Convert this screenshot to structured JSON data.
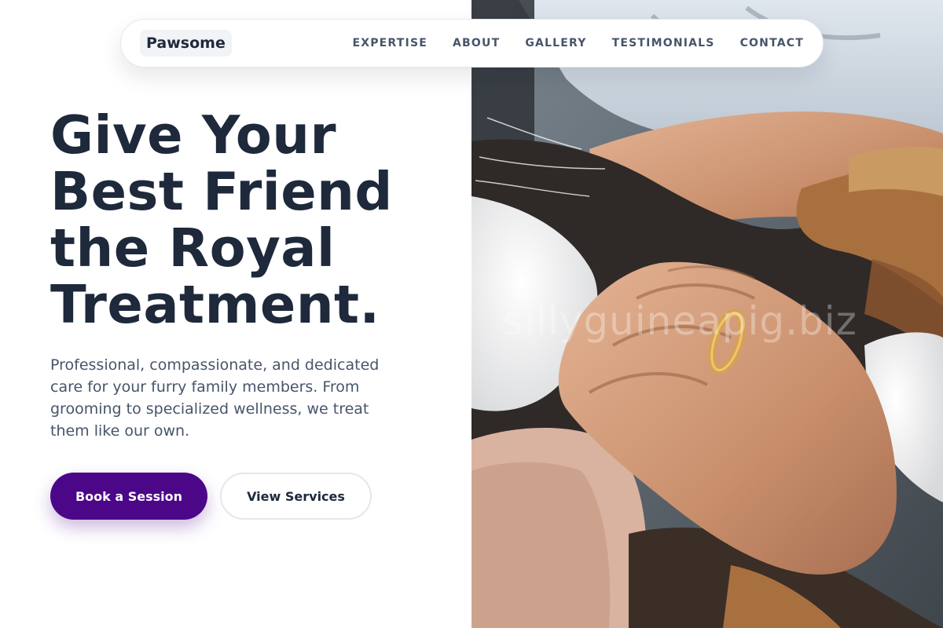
{
  "nav": {
    "brand": "Pawsome",
    "links": [
      "EXPERTISE",
      "ABOUT",
      "GALLERY",
      "TESTIMONIALS",
      "CONTACT"
    ]
  },
  "hero": {
    "headline_lines": [
      "Give Your",
      "Best Friend",
      "the Royal",
      "Treatment."
    ],
    "subtext": "Professional, compassionate, and dedicated care for your furry family members. From grooming to specialized wellness, we treat them like our own.",
    "primary_button": "Book a Session",
    "secondary_button": "View Services"
  },
  "photo": {
    "subject": "hands petting a calico cat",
    "watermark": "sillyguineapig.biz"
  },
  "colors": {
    "heading": "#1e293b",
    "body_text": "#475569",
    "primary_button": "#4c0788",
    "nav_border": "#e5e7eb"
  }
}
